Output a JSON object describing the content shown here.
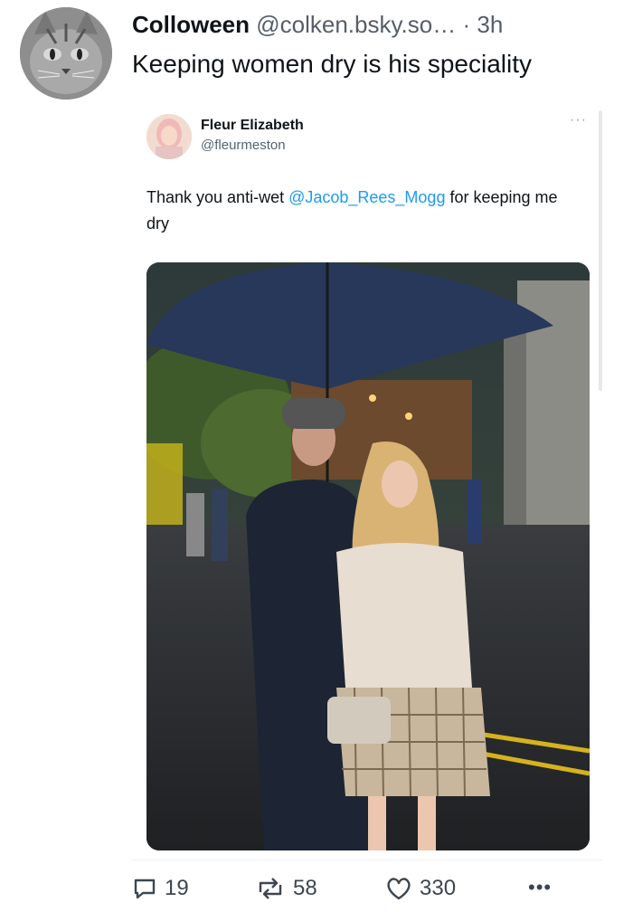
{
  "post": {
    "author_name": "Colloween",
    "author_handle": "@colken.bsky.so…",
    "separator": "·",
    "time": "3h",
    "text": "Keeping women dry is his speciality"
  },
  "quote": {
    "author_name": "Fleur Elizabeth",
    "author_handle": "@fleurmeston",
    "more": "···",
    "text_before": "Thank you anti-wet ",
    "mention": "@Jacob_Rees_Mogg",
    "text_after": " for keeping me dry",
    "image_alt": "photo"
  },
  "actions": {
    "replies": "19",
    "reposts": "58",
    "likes": "330",
    "more": "•••"
  },
  "colors": {
    "mention": "#1d9bf0",
    "action_icon": "#3d4650"
  },
  "icons": [
    "cat-avatar-icon",
    "reply-icon",
    "repost-icon",
    "like-icon",
    "more-icon"
  ]
}
